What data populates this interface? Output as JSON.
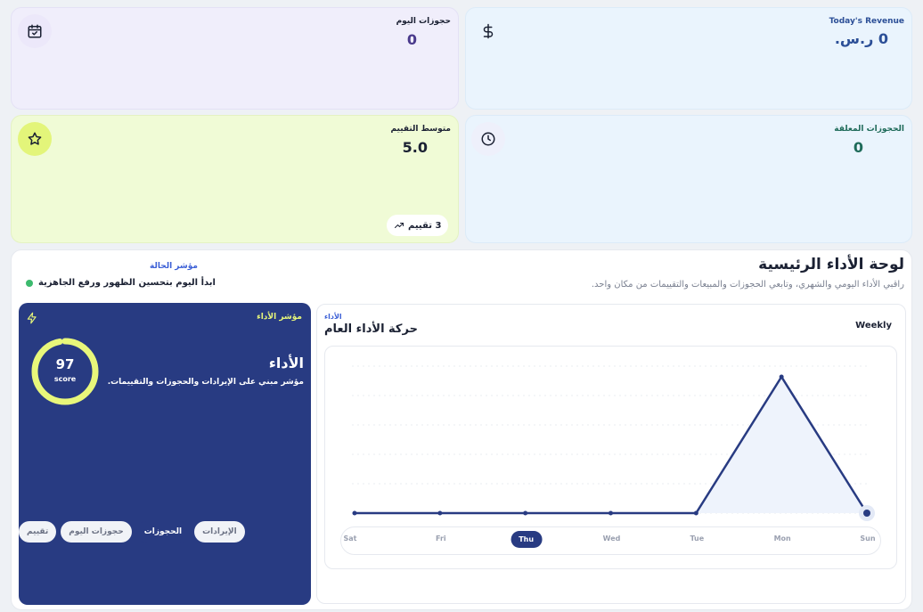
{
  "kpis": {
    "revenue": {
      "label": "Today's Revenue",
      "value": "0 ر.س."
    },
    "today": {
      "label": "حجوزات اليوم",
      "value": "0"
    },
    "pending": {
      "label": "الحجوزات المعلقة",
      "value": "0"
    },
    "rating": {
      "label": "متوسط التقييم",
      "value": "5.0",
      "badge": "3 تقييم"
    }
  },
  "dashboard": {
    "title": "لوحة الأداء الرئيسية",
    "subtitle": "راقبي الأداء اليومي والشهري، وتابعي الحجوزات والمبيعات والتقييمات من مكان واحد."
  },
  "status": {
    "label": "مؤشر الحالة",
    "text": "ابدأ اليوم بتحسين الظهور ورفع الجاهزية"
  },
  "performance": {
    "tag": "مؤشر الأداء",
    "title": "الأداء",
    "description": "مؤشر مبني على الإيرادات والحجوزات والتقييمات.",
    "score": "97",
    "score_unit": "score",
    "score_fraction": 0.97
  },
  "chart": {
    "tag": "الأداء",
    "title": "حركة الأداء العام",
    "period": "Weekly"
  },
  "chart_data": {
    "type": "area",
    "categories": [
      "Sat",
      "Fri",
      "Thu",
      "Wed",
      "Tue",
      "Mon",
      "Sun"
    ],
    "values": [
      0,
      0,
      0,
      0,
      0,
      1,
      0
    ],
    "active_category": "Thu",
    "grid": true
  },
  "tabs": [
    {
      "label": "الإيرادات",
      "active": false
    },
    {
      "label": "الحجوزات",
      "active": true
    },
    {
      "label": "حجوزات اليوم",
      "active": false
    },
    {
      "label": "تقييم",
      "active": false
    }
  ],
  "colors": {
    "primary": "#283b82",
    "accent": "#e8f77a",
    "status_ok": "#3cba6e",
    "link": "#3b5fd6"
  }
}
